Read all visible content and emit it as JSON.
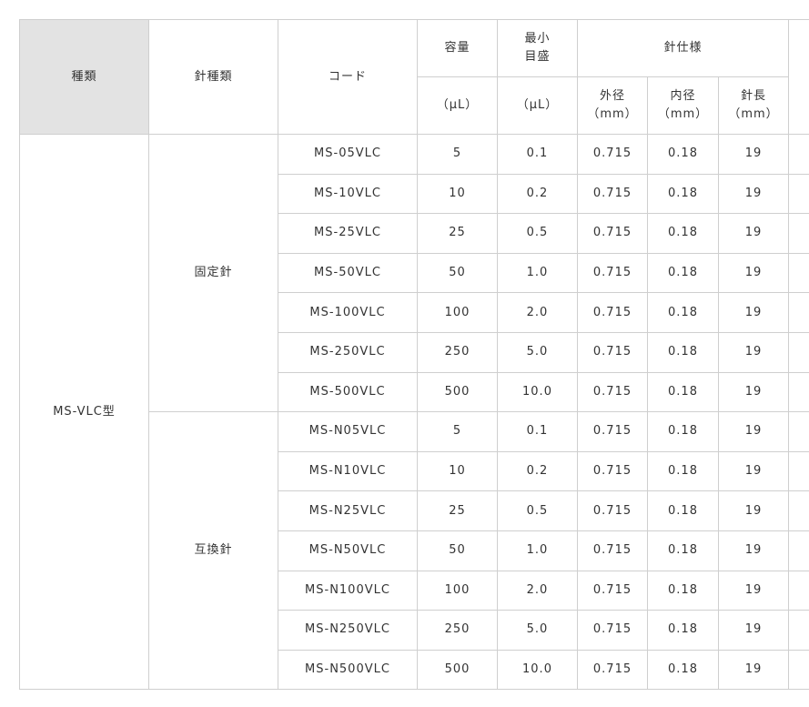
{
  "header": {
    "type": "種類",
    "needle_type": "針種類",
    "code": "コード",
    "capacity": "容量",
    "capacity_unit": "（μL）",
    "min_scale_line1": "最小",
    "min_scale_line2": "目盛",
    "min_scale_unit": "（μL）",
    "needle_spec": "針仕様",
    "outer_dia": "外径",
    "outer_dia_unit": "（mm）",
    "inner_dia": "内径",
    "inner_dia_unit": "（mm）",
    "needle_len": "針長",
    "needle_len_unit": "（mm）"
  },
  "type_name": "MS-VLC型",
  "groups": [
    {
      "needle_type": "固定針",
      "rows": [
        {
          "code": "MS-05VLC",
          "capacity": "5",
          "min_scale": "0.1",
          "outer": "0.715",
          "inner": "0.18",
          "length": "19"
        },
        {
          "code": "MS-10VLC",
          "capacity": "10",
          "min_scale": "0.2",
          "outer": "0.715",
          "inner": "0.18",
          "length": "19"
        },
        {
          "code": "MS-25VLC",
          "capacity": "25",
          "min_scale": "0.5",
          "outer": "0.715",
          "inner": "0.18",
          "length": "19"
        },
        {
          "code": "MS-50VLC",
          "capacity": "50",
          "min_scale": "1.0",
          "outer": "0.715",
          "inner": "0.18",
          "length": "19"
        },
        {
          "code": "MS-100VLC",
          "capacity": "100",
          "min_scale": "2.0",
          "outer": "0.715",
          "inner": "0.18",
          "length": "19"
        },
        {
          "code": "MS-250VLC",
          "capacity": "250",
          "min_scale": "5.0",
          "outer": "0.715",
          "inner": "0.18",
          "length": "19"
        },
        {
          "code": "MS-500VLC",
          "capacity": "500",
          "min_scale": "10.0",
          "outer": "0.715",
          "inner": "0.18",
          "length": "19"
        }
      ]
    },
    {
      "needle_type": "互換針",
      "rows": [
        {
          "code": "MS-N05VLC",
          "capacity": "5",
          "min_scale": "0.1",
          "outer": "0.715",
          "inner": "0.18",
          "length": "19"
        },
        {
          "code": "MS-N10VLC",
          "capacity": "10",
          "min_scale": "0.2",
          "outer": "0.715",
          "inner": "0.18",
          "length": "19"
        },
        {
          "code": "MS-N25VLC",
          "capacity": "25",
          "min_scale": "0.5",
          "outer": "0.715",
          "inner": "0.18",
          "length": "19"
        },
        {
          "code": "MS-N50VLC",
          "capacity": "50",
          "min_scale": "1.0",
          "outer": "0.715",
          "inner": "0.18",
          "length": "19"
        },
        {
          "code": "MS-N100VLC",
          "capacity": "100",
          "min_scale": "2.0",
          "outer": "0.715",
          "inner": "0.18",
          "length": "19"
        },
        {
          "code": "MS-N250VLC",
          "capacity": "250",
          "min_scale": "5.0",
          "outer": "0.715",
          "inner": "0.18",
          "length": "19"
        },
        {
          "code": "MS-N500VLC",
          "capacity": "500",
          "min_scale": "10.0",
          "outer": "0.715",
          "inner": "0.18",
          "length": "19"
        }
      ]
    }
  ],
  "colors": {
    "header_shade": "#e3e3e3",
    "border": "#cfcfcf",
    "text": "#333333"
  }
}
